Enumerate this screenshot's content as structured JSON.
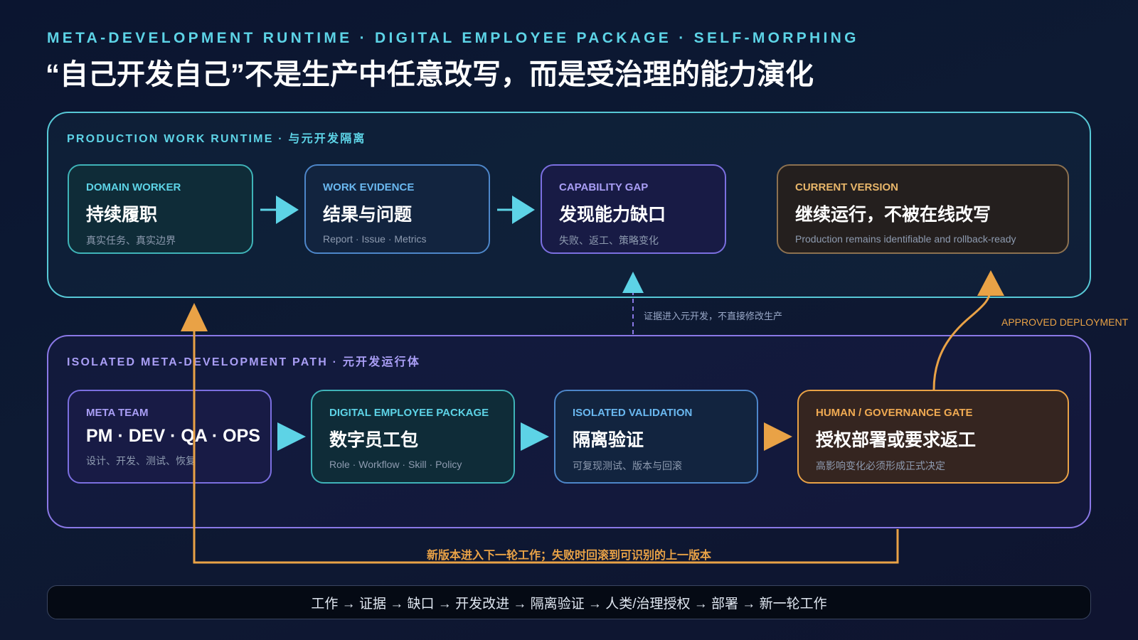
{
  "header": {
    "kicker": "META-DEVELOPMENT RUNTIME · DIGITAL EMPLOYEE PACKAGE · SELF-MORPHING",
    "title": "“自己开发自己”不是生产中任意改写，而是受治理的能力演化"
  },
  "production": {
    "label": "PRODUCTION WORK RUNTIME · 与元开发隔离",
    "cards": [
      {
        "kicker": "DOMAIN WORKER",
        "title": "持续履职",
        "sub": "真实任务、真实边界"
      },
      {
        "kicker": "WORK EVIDENCE",
        "title": "结果与问题",
        "sub": "Report · Issue · Metrics"
      },
      {
        "kicker": "CAPABILITY GAP",
        "title": "发现能力缺口",
        "sub": "失败、返工、策略变化"
      },
      {
        "kicker": "CURRENT VERSION",
        "title": "继续运行，不被在线改写",
        "sub": "Production remains identifiable and rollback-ready"
      }
    ]
  },
  "meta": {
    "label": "ISOLATED META-DEVELOPMENT PATH · 元开发运行体",
    "cards": [
      {
        "kicker": "META TEAM",
        "title": "PM · DEV · QA · OPS",
        "sub": "设计、开发、测试、恢复"
      },
      {
        "kicker": "DIGITAL EMPLOYEE PACKAGE",
        "title": "数字员工包",
        "sub": "Role · Workflow · Skill · Policy"
      },
      {
        "kicker": "ISOLATED VALIDATION",
        "title": "隔离验证",
        "sub": "可复现测试、版本与回滚"
      },
      {
        "kicker": "HUMAN / GOVERNANCE GATE",
        "title": "授权部署或要求返工",
        "sub": "高影响变化必须形成正式决定"
      }
    ]
  },
  "notes": {
    "evidence": "证据进入元开发，不直接修改生产",
    "deployment": "APPROVED DEPLOYMENT",
    "loop": "新版本进入下一轮工作；失败时回滚到可识别的上一版本"
  },
  "footer": {
    "flow": "工作 → 证据 → 缺口 → 开发改进 → 隔离验证 → 人类/治理授权 → 部署 → 新一轮工作"
  },
  "colors": {
    "teal": "#57c8d6",
    "violet": "#8a78e6",
    "orange": "#e9a246",
    "arrow_cyan": "#5dd3e6"
  }
}
